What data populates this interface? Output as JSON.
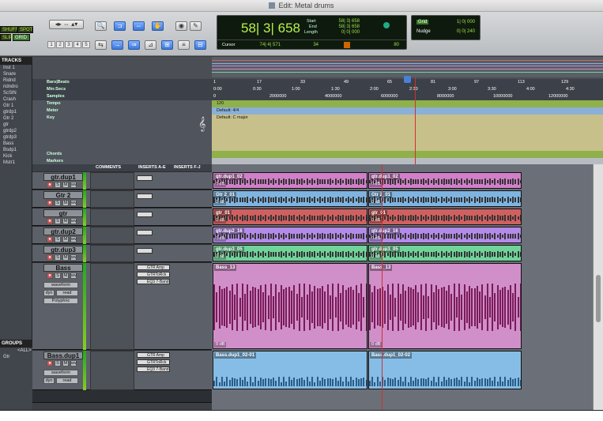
{
  "window": {
    "title": "Edit: Metal drums"
  },
  "toolbar": {
    "modes": [
      "SHUFFLE",
      "SPOT",
      "SLIP",
      "GRID"
    ],
    "zoom_presets": [
      "1",
      "2",
      "3",
      "4",
      "5"
    ],
    "counter": {
      "main": "58| 3| 658",
      "start_label": "Start",
      "start": "58| 3| 658",
      "end_label": "End",
      "end": "58| 3| 658",
      "length_label": "Length",
      "length": "0| 0| 000",
      "cursor_label": "Cursor",
      "cursor": "74| 4| 571",
      "sel_val": "34",
      "tempo": "80"
    },
    "grid": {
      "label": "Grid",
      "value": "1| 0| 000",
      "nudge_label": "Nudge",
      "nudge_value": "0| 0| 240"
    }
  },
  "tracks_panel": {
    "header": "TRACKS",
    "items": [
      "Inst 1",
      "Snare",
      "Ridnd",
      "ridndro",
      "ScSlN",
      "Crash",
      "Gtr 1",
      "gtrdp1",
      "Gtr 2",
      "gtr",
      "gtrdp2",
      "gtrdp3",
      "Bass",
      "Bsdp1",
      "Kick",
      "Mstr1"
    ]
  },
  "groups_panel": {
    "header": "GROUPS",
    "all": "<ALL>",
    "item": "Gtr"
  },
  "rulers": {
    "bars_label": "Bars|Beats",
    "bars": [
      "1",
      "17",
      "33",
      "49",
      "65",
      "81",
      "97",
      "113",
      "129"
    ],
    "minsecs_label": "Min:Secs",
    "minsecs": [
      "0:00",
      "0:30",
      "1:00",
      "1:30",
      "2:00",
      "2:30",
      "3:00",
      "3:30",
      "4:00",
      "4:30"
    ],
    "samples_label": "Samples",
    "samples": [
      "0",
      "2000000",
      "4000000",
      "6000000",
      "8000000",
      "10000000",
      "12000000"
    ],
    "tempo_label": "Tempo",
    "tempo_value": "120",
    "meter_label": "Meter",
    "meter_value": "Default: 4/4",
    "key_label": "Key",
    "key_value": "Default: C major",
    "chords_label": "Chords",
    "markers_label": "Markers"
  },
  "columns": {
    "comments": "COMMENTS",
    "inserts_ae": "INSERTS A-E",
    "inserts_fj": "INSERTS F-J"
  },
  "tracks": [
    {
      "name": "gtr.dup1",
      "color": "#d07fc8",
      "clips": [
        "gtr.dup1_02",
        "gtr.dup1_02"
      ],
      "db": "0 dB"
    },
    {
      "name": "Gtr 2",
      "color": "#7fb4e0",
      "clips": [
        "Gtr 2_01",
        "Gtr 2_01"
      ],
      "db": "0 dB"
    },
    {
      "name": "gtr",
      "color": "#d06060",
      "clips": [
        "gtr_01",
        "gtr_01"
      ],
      "db": "0 dB"
    },
    {
      "name": "gtr.dup2",
      "color": "#b48be8",
      "clips": [
        "gtr.dup2_16",
        "gtr.dup2_16"
      ],
      "db": "0 dB"
    },
    {
      "name": "gtr.dup3",
      "color": "#6fd39a",
      "clips": [
        "gtr.dup3_05",
        "gtr.dup3_05"
      ],
      "db": "0 dB"
    },
    {
      "name": "Bass",
      "color": "#d08fc8",
      "clips": [
        "Bass_13",
        "Bass_13"
      ],
      "db": "0 dB",
      "view": "waveform",
      "mode": "read",
      "dyn": "dyn",
      "voice": "Polyphnc",
      "inserts": [
        "GTR Amp",
        "GTRToRck",
        "EQ3 7-Band"
      ]
    },
    {
      "name": "Bass.dup1",
      "color": "#86bde6",
      "clips": [
        "Bass.dup1_02-01",
        "Bass.dup1_02-02"
      ],
      "view": "waveform",
      "mode": "read",
      "dyn": "dyn",
      "inserts": [
        "GTR Amp",
        "GTRToRck",
        "EQ3 7-Band"
      ]
    }
  ]
}
